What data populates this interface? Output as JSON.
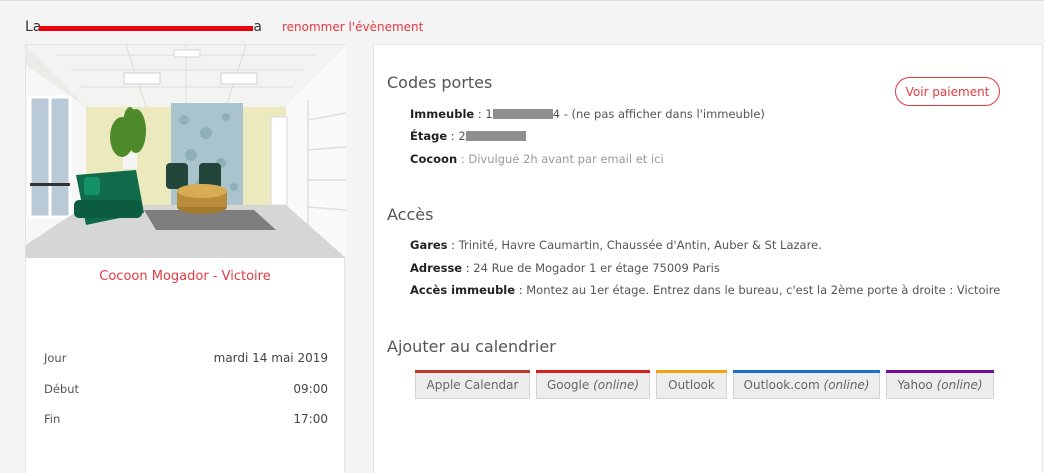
{
  "header": {
    "event_title_start": "La",
    "event_title_end": "a",
    "rename_label": "renommer l'évènement"
  },
  "room": {
    "name": "Cocoon Mogador - Victoire"
  },
  "schedule": {
    "rows": [
      {
        "label": "Jour",
        "value": "mardi 14 mai 2019"
      },
      {
        "label": "Début",
        "value": "09:00"
      },
      {
        "label": "Fin",
        "value": "17:00"
      }
    ]
  },
  "codes": {
    "title": "Codes portes",
    "pay_button": "Voir paiement",
    "immeuble_label": "Immeuble",
    "immeuble_prefix": "1",
    "immeuble_suffix": "4 - (ne pas afficher dans l'immeuble)",
    "etage_label": "Étage",
    "etage_prefix": "2",
    "cocoon_label": "Cocoon",
    "cocoon_value": "Divulgué 2h avant par email et ici"
  },
  "acces": {
    "title": "Accès",
    "gares_label": "Gares",
    "gares_value": "Trinité, Havre Caumartin, Chaussée d'Antin, Auber & St Lazare.",
    "adresse_label": "Adresse",
    "adresse_value": "24 Rue de Mogador 1 er étage 75009 Paris",
    "acces_label": "Accès immeuble",
    "acces_value": "Montez au 1er étage. Entrez dans le bureau, c'est la 2ème porte à droite : Victoire"
  },
  "calendar": {
    "title": "Ajouter au calendrier",
    "buttons": [
      {
        "label": "Apple Calendar",
        "sub": "",
        "color": "#c0392b"
      },
      {
        "label": "Google",
        "sub": "(online)",
        "color": "#d81f1f"
      },
      {
        "label": "Outlook",
        "sub": "",
        "color": "#f0a30a"
      },
      {
        "label": "Outlook.com",
        "sub": "(online)",
        "color": "#1c6fc9"
      },
      {
        "label": "Yahoo",
        "sub": "(online)",
        "color": "#720e9e"
      }
    ]
  },
  "colors": {
    "accent": "#e5393f",
    "redaction": "#e8000b"
  }
}
